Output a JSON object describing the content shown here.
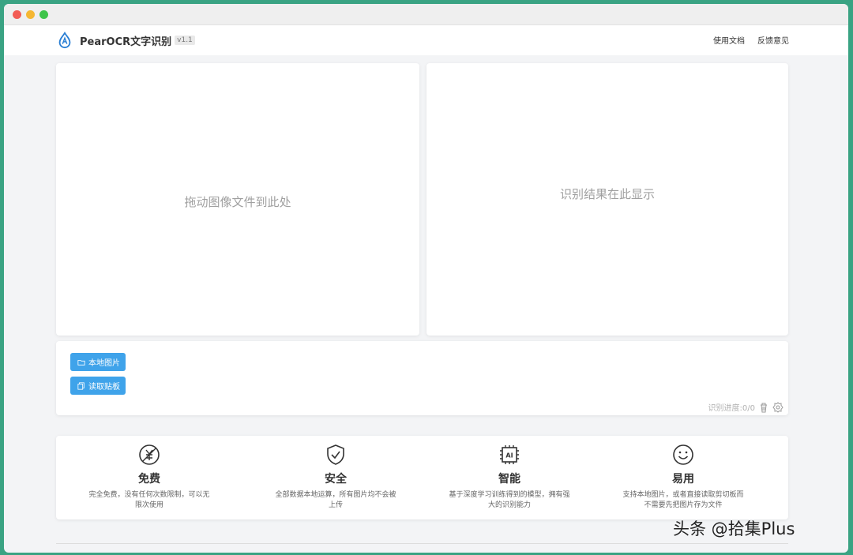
{
  "app": {
    "name": "PearOCR文字识别",
    "version": "v1.1"
  },
  "nav": {
    "docs": "使用文档",
    "feedback": "反馈意见"
  },
  "dropzone": {
    "hint": "拖动图像文件到此处"
  },
  "result": {
    "hint": "识别结果在此显示"
  },
  "toolbar": {
    "local_image": "本地图片",
    "read_clipboard": "读取贴板",
    "progress": "识别进度:0/0"
  },
  "features": [
    {
      "title": "免费",
      "desc": "完全免费，没有任何次数限制，可以无限次使用",
      "icon": "free-icon"
    },
    {
      "title": "安全",
      "desc": "全部数据本地运算，所有图片均不会被上传",
      "icon": "shield-check-icon"
    },
    {
      "title": "智能",
      "desc": "基于深度学习训练得到的模型，拥有强大的识别能力",
      "icon": "ai-chip-icon"
    },
    {
      "title": "易用",
      "desc": "支持本地图片，或者直接读取剪切板而不需要先把图片存为文件",
      "icon": "smile-icon"
    }
  ],
  "watermark": "头条 @拾集Plus",
  "colors": {
    "accent": "#3fa3ea",
    "background": "#3aa383"
  }
}
